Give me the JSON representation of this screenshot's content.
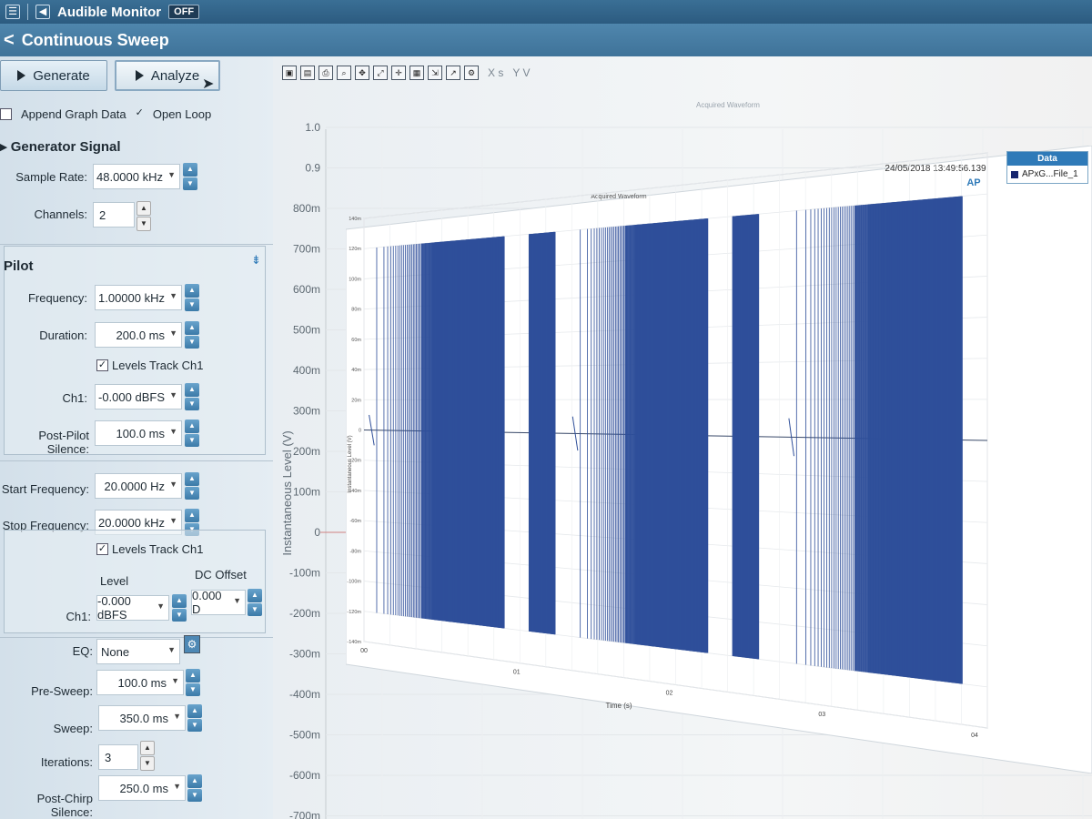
{
  "header": {
    "monitor_label": "Audible Monitor",
    "monitor_state": "OFF",
    "back_glyph": "<",
    "page_title": "Continuous Sweep"
  },
  "actions": {
    "generate_label": "Generate",
    "analyze_label": "Analyze"
  },
  "options": {
    "append_graph_data": "Append Graph Data",
    "open_loop": "Open Loop",
    "open_loop_checked": true,
    "append_checked": false
  },
  "generator": {
    "section_title": "Generator Signal",
    "sample_rate_label": "Sample Rate:",
    "sample_rate_value": "48.0000 kHz",
    "channels_label": "Channels:",
    "channels_value": "2"
  },
  "pilot": {
    "section_title": "Pilot",
    "frequency_label": "Frequency:",
    "frequency_value": "1.00000 kHz",
    "duration_label": "Duration:",
    "duration_value": "200.0 ms",
    "levels_track_label": "Levels Track Ch1",
    "ch1_label": "Ch1:",
    "ch1_value": "-0.000 dBFS",
    "post_pilot_label": "Post-Pilot Silence:",
    "post_pilot_value": "100.0 ms"
  },
  "sweep": {
    "start_label": "Start Frequency:",
    "start_value": "20.0000 Hz",
    "stop_label": "Stop Frequency:",
    "stop_value": "20.0000 kHz",
    "levels_track_label": "Levels Track Ch1",
    "level_header": "Level",
    "dc_offset_header": "DC Offset",
    "ch1_label": "Ch1:",
    "ch1_level_value": "-0.000 dBFS",
    "ch1_dc_value": "0.000 D",
    "eq_label": "EQ:",
    "eq_value": "None",
    "pre_sweep_label": "Pre-Sweep:",
    "pre_sweep_value": "100.0 ms",
    "sweep_label": "Sweep:",
    "sweep_value": "350.0 ms",
    "iterations_label": "Iterations:",
    "iterations_value": "3",
    "post_chirp_label": "Post-Chirp Silence:",
    "post_chirp_value": "250.0 ms"
  },
  "graph_toolbar": {
    "x_axis_label": "X s",
    "y_axis_label": "Y V"
  },
  "background_chart": {
    "ylabel": "Instantaneous Level (V)",
    "y_ticks": [
      "1.0",
      "0.9",
      "800m",
      "700m",
      "600m",
      "500m",
      "400m",
      "300m",
      "200m",
      "100m",
      "0",
      "-100m",
      "-200m",
      "-300m",
      "-400m",
      "-500m",
      "-600m",
      "-700m"
    ],
    "title_faint": "Acquired Waveform"
  },
  "chart_data": {
    "type": "line",
    "title": "Acquired Waveform",
    "timestamp": "24/05/2018 13:49:56.139",
    "logo": "AP",
    "xlabel": "Time (s)",
    "ylabel": "Instantaneous Level (V)",
    "x_ticks": [
      "00",
      "01",
      "02",
      "03",
      "04"
    ],
    "y_ticks": [
      "140m",
      "120m",
      "100m",
      "80m",
      "60m",
      "40m",
      "20m",
      "0",
      "-20m",
      "-40m",
      "-60m",
      "-80m",
      "-100m",
      "-120m",
      "-140m"
    ],
    "ylim": [
      -0.14,
      0.14
    ],
    "grid": true,
    "legend_position": "top-right",
    "series": [
      {
        "name": "APxG...File_1",
        "color": "#2f4f9a",
        "segments": [
          {
            "kind": "sweep",
            "start": 0.05,
            "end": 0.55,
            "amplitude": 0.12
          },
          {
            "kind": "pilot",
            "start": 0.65,
            "end": 0.75,
            "amplitude": 0.12
          },
          {
            "kind": "sweep",
            "start": 0.85,
            "end": 1.35,
            "amplitude": 0.12
          },
          {
            "kind": "pilot",
            "start": 1.45,
            "end": 1.55,
            "amplitude": 0.12
          },
          {
            "kind": "sweep",
            "start": 1.7,
            "end": 2.35,
            "amplitude": 0.12
          }
        ]
      }
    ]
  },
  "legend": {
    "header": "Data",
    "item": "APxG...File_1"
  }
}
